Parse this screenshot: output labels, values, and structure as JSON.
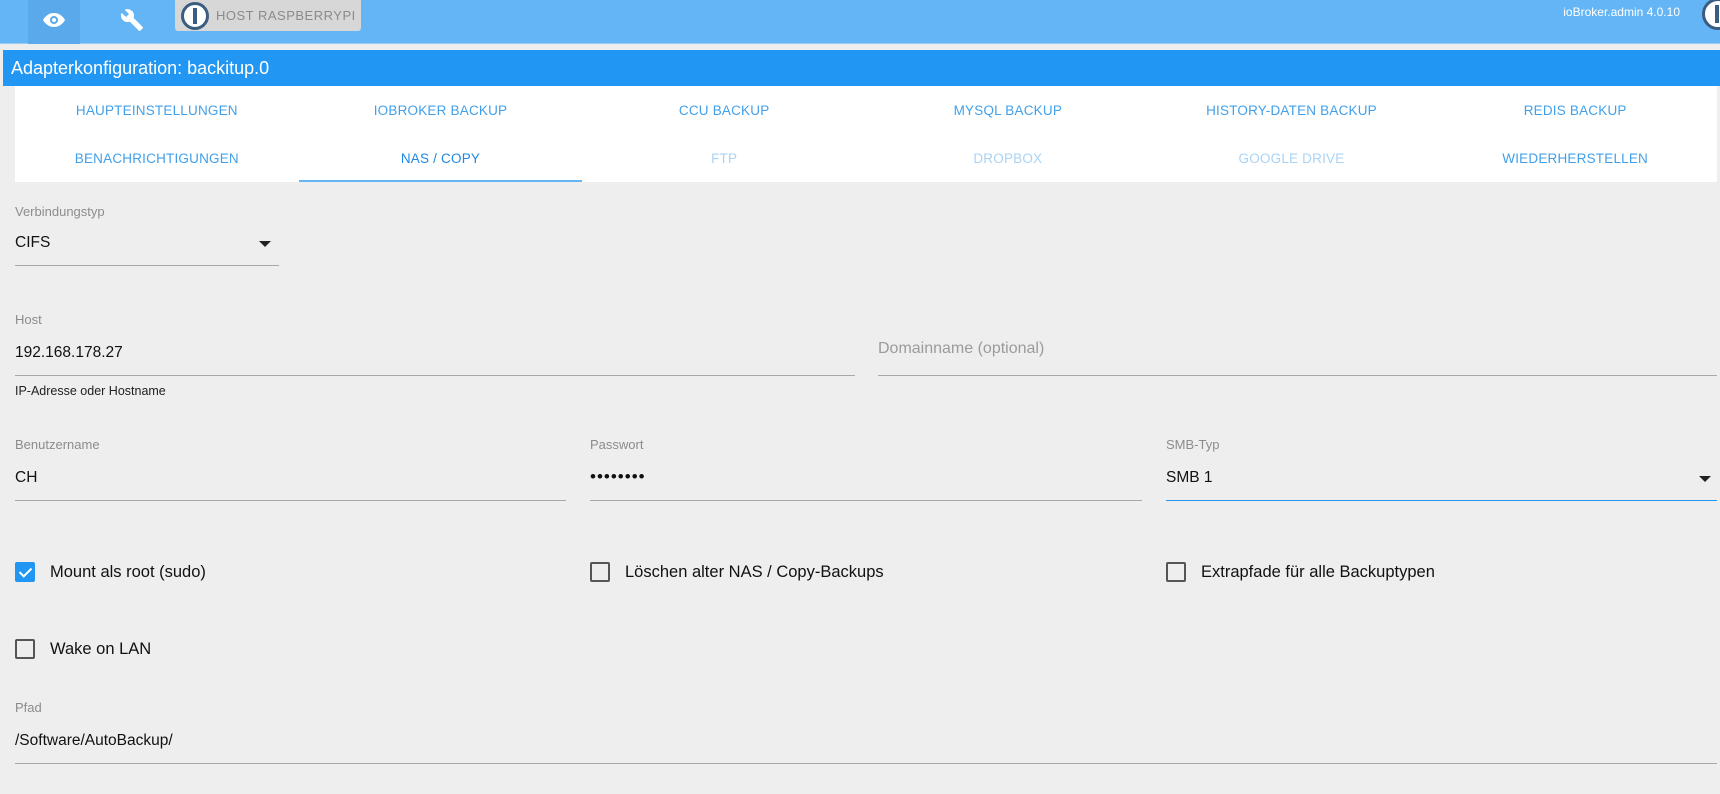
{
  "topbar": {
    "host_label": "HOST RASPBERRYPI",
    "version": "ioBroker.admin 4.0.10",
    "icons": [
      "eye-icon",
      "wrench-icon",
      "iobroker-logo-icon"
    ]
  },
  "dialog": {
    "title": "Adapterkonfiguration: backitup.0"
  },
  "tabs": [
    {
      "label": "HAUPTEINSTELLUNGEN",
      "state": "normal"
    },
    {
      "label": "IOBROKER BACKUP",
      "state": "normal"
    },
    {
      "label": "CCU BACKUP",
      "state": "normal"
    },
    {
      "label": "MYSQL BACKUP",
      "state": "normal"
    },
    {
      "label": "HISTORY-DATEN BACKUP",
      "state": "normal"
    },
    {
      "label": "REDIS BACKUP",
      "state": "normal"
    },
    {
      "label": "BENACHRICHTIGUNGEN",
      "state": "normal"
    },
    {
      "label": "NAS / COPY",
      "state": "active"
    },
    {
      "label": "FTP",
      "state": "disabled"
    },
    {
      "label": "DROPBOX",
      "state": "disabled"
    },
    {
      "label": "GOOGLE DRIVE",
      "state": "disabled"
    },
    {
      "label": "WIEDERHERSTELLEN",
      "state": "normal"
    }
  ],
  "form": {
    "connection_type": {
      "label": "Verbindungstyp",
      "value": "CIFS"
    },
    "host": {
      "label": "Host",
      "value": "192.168.178.27",
      "helper": "IP-Adresse oder Hostname"
    },
    "domain": {
      "placeholder": "Domainname (optional)"
    },
    "username": {
      "label": "Benutzername",
      "value": "CH"
    },
    "password": {
      "label": "Passwort",
      "value": "••••••••"
    },
    "smb_type": {
      "label": "SMB-Typ",
      "value": "SMB 1"
    },
    "mount_root": {
      "label": "Mount als root (sudo)",
      "checked": true
    },
    "delete_old": {
      "label": "Löschen alter NAS / Copy-Backups",
      "checked": false
    },
    "extra_paths": {
      "label": "Extrapfade für alle Backuptypen",
      "checked": false
    },
    "wake_on_lan": {
      "label": "Wake on LAN",
      "checked": false
    },
    "path": {
      "label": "Pfad",
      "value": "/Software/AutoBackup/"
    }
  },
  "colors": {
    "topbar": "#64b5f6",
    "title_bar": "#2196f3",
    "tab_text": "#42a0ea",
    "tab_disabled": "#a9d3f5",
    "checkbox_checked": "#2196f3",
    "background": "#eeeeee"
  }
}
